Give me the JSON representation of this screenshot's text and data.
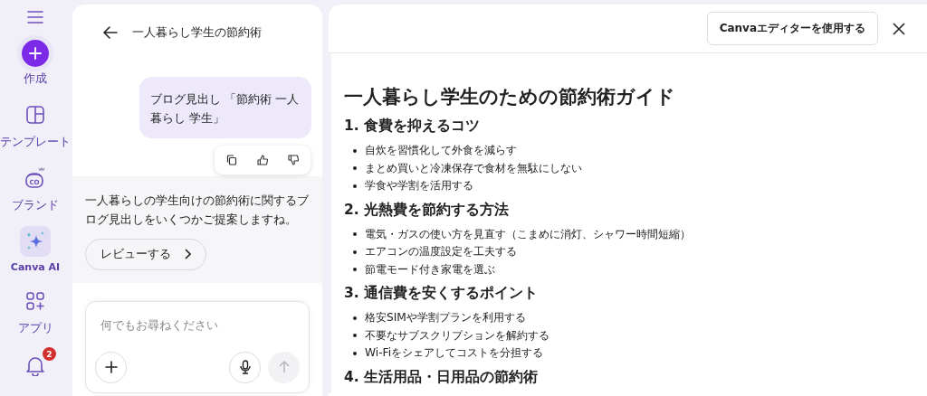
{
  "nav": [
    {
      "kind": "menu"
    },
    {
      "kind": "create",
      "label": "作成"
    },
    {
      "kind": "template",
      "label": "テンプレート",
      "selected": false
    },
    {
      "kind": "brand",
      "label": "ブランド",
      "icon_text": "CO",
      "selected": false
    },
    {
      "kind": "ai",
      "label": "Canva AI",
      "selected": true
    },
    {
      "kind": "apps",
      "label": "アプリ",
      "selected": false
    },
    {
      "kind": "bell",
      "badge": "2"
    }
  ],
  "chat": {
    "title": "一人暮らし学生の節約術",
    "user_message": "ブログ見出し 「節約術 一人暮らし 学生」",
    "assistant_message": "一人暮らしの学生向けの節約術に関するブログ見出しをいくつかご提案しますね。",
    "review_button": "レビューする",
    "input": {
      "placeholder": "何でもお尋ねください",
      "send_disabled": true
    }
  },
  "document": {
    "editor_button": "Canvaエディターを使用する",
    "title": "一人暮らし学生のための節約術ガイド",
    "sections": [
      {
        "heading": "1. 食費を抑えるコツ",
        "items": [
          "自炊を習慣化して外食を減らす",
          "まとめ買いと冷凍保存で食材を無駄にしない",
          "学食や学割を活用する"
        ]
      },
      {
        "heading": "2. 光熱費を節約する方法",
        "items": [
          "電気・ガスの使い方を見直す（こまめに消灯、シャワー時間短縮）",
          "エアコンの温度設定を工夫する",
          "節電モード付き家電を選ぶ"
        ]
      },
      {
        "heading": "3. 通信費を安くするポイント",
        "items": [
          "格安SIMや学割プランを利用する",
          "不要なサブスクリプションを解約する",
          "Wi-Fiをシェアしてコストを分担する"
        ]
      },
      {
        "heading": "4. 生活用品・日用品の節約術"
      }
    ]
  }
}
